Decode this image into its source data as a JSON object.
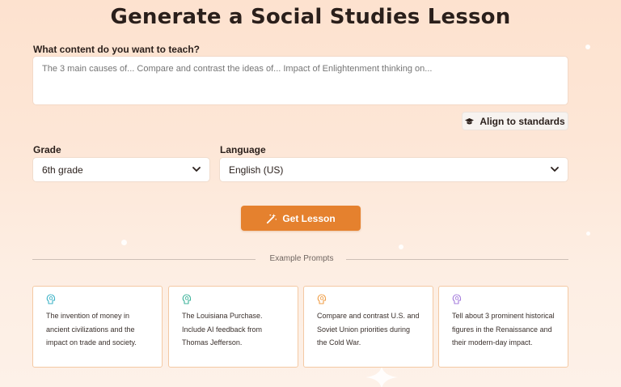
{
  "page": {
    "title": "Generate a Social Studies Lesson"
  },
  "content": {
    "label": "What content do you want to teach?",
    "placeholder": "The 3 main causes of... Compare and contrast the ideas of... Impact of Enlightenment thinking on...",
    "value": ""
  },
  "align": {
    "label": "Align to standards",
    "icon": "graduation-cap-icon"
  },
  "grade": {
    "label": "Grade",
    "selected": "6th grade",
    "icon": "chevron-down-icon"
  },
  "language": {
    "label": "Language",
    "selected": "English (US)",
    "icon": "chevron-down-icon"
  },
  "get_lesson": {
    "label": "Get Lesson",
    "icon": "magic-wand-icon",
    "color": "#e5812e"
  },
  "examples": {
    "heading": "Example Prompts",
    "cards": [
      {
        "text": "The invention of money in ancient civilizations and the impact on trade and society.",
        "icon": "globe-head-icon",
        "icon_color": "#3fb3c7"
      },
      {
        "text": "The Louisiana Purchase. Include AI feedback from Thomas Jefferson.",
        "icon": "globe-head-icon",
        "icon_color": "#3fb39b"
      },
      {
        "text": "Compare and contrast U.S. and Soviet Union priorities during the Cold War.",
        "icon": "globe-head-icon",
        "icon_color": "#f0a04b"
      },
      {
        "text": "Tell about 3 prominent historical figures in the Renaissance and their modern-day impact.",
        "icon": "globe-head-icon",
        "icon_color": "#a57ddc"
      }
    ]
  },
  "colors": {
    "accent": "#e5812e",
    "card_border": "#f4c9a4",
    "background_top": "#fde2cf",
    "background_bottom": "#fdf1e8"
  }
}
